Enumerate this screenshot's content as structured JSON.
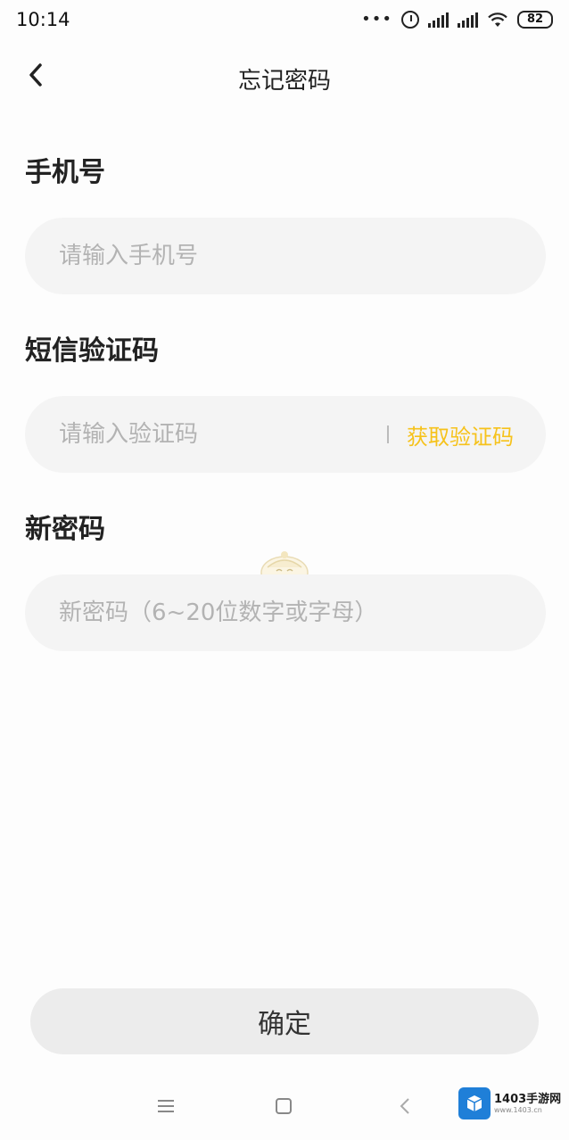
{
  "status_bar": {
    "time": "10:14",
    "dots": "•••",
    "battery": "82"
  },
  "header": {
    "title": "忘记密码"
  },
  "form": {
    "phone": {
      "label": "手机号",
      "placeholder": "请输入手机号",
      "value": ""
    },
    "sms_code": {
      "label": "短信验证码",
      "placeholder": "请输入验证码",
      "value": "",
      "get_code_label": "获取验证码"
    },
    "new_password": {
      "label": "新密码",
      "placeholder": "新密码（6~20位数字或字母）",
      "value": ""
    }
  },
  "confirm_button": {
    "label": "确定"
  },
  "watermark": {
    "main": "1403手游网",
    "sub": "www.1403.cn"
  },
  "colors": {
    "accent": "#f6c21b",
    "field_bg": "#f4f4f4",
    "button_bg": "#ececec",
    "watermark_blue": "#1f7fd8"
  },
  "icons": {
    "back": "chevron-left-icon",
    "menu": "menu-icon",
    "home": "home-square-icon",
    "nav_back": "triangle-back-icon"
  }
}
